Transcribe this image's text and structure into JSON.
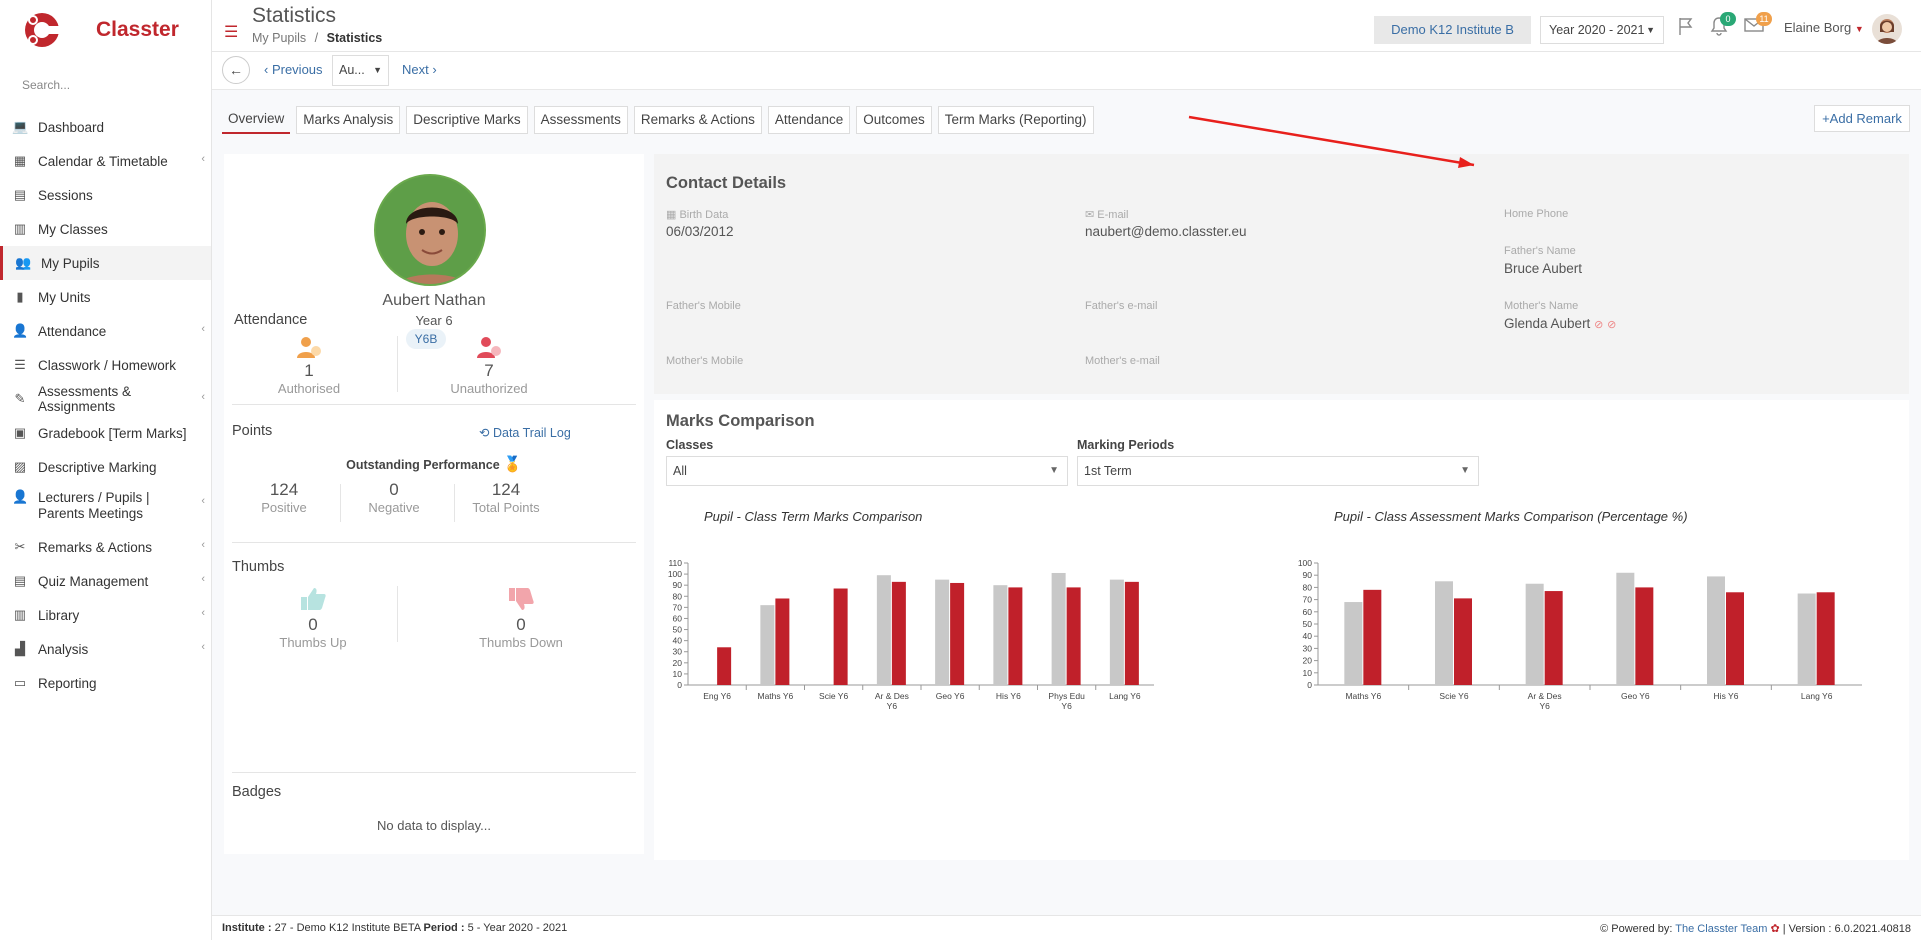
{
  "app": {
    "brand": "Classter",
    "search_placeholder": "Search..."
  },
  "sidebar": {
    "items": [
      {
        "label": "Dashboard",
        "icon": "laptop-icon"
      },
      {
        "label": "Calendar & Timetable",
        "icon": "calendar-icon",
        "arrow": true
      },
      {
        "label": "Sessions",
        "icon": "sessions-icon"
      },
      {
        "label": "My Classes",
        "icon": "classes-icon"
      },
      {
        "label": "My Pupils",
        "icon": "pupils-icon",
        "active": true
      },
      {
        "label": "My Units",
        "icon": "book-icon"
      },
      {
        "label": "Attendance",
        "icon": "attendance-icon",
        "arrow": true
      },
      {
        "label": "Classwork / Homework",
        "icon": "list-icon"
      },
      {
        "label": "Assessments & Assignments",
        "icon": "edit-icon",
        "arrow": true
      },
      {
        "label": "Gradebook [Term Marks]",
        "icon": "gradebook-icon"
      },
      {
        "label": "Descriptive Marking",
        "icon": "descriptive-icon"
      },
      {
        "label": "Lecturers / Pupils | Parents Meetings",
        "icon": "meetings-icon",
        "arrow": true,
        "two": true
      },
      {
        "label": "Remarks & Actions",
        "icon": "remarks-icon",
        "arrow": true
      },
      {
        "label": "Quiz Management",
        "icon": "quiz-icon",
        "arrow": true
      },
      {
        "label": "Library",
        "icon": "library-icon",
        "arrow": true
      },
      {
        "label": "Analysis",
        "icon": "analysis-icon",
        "arrow": true
      },
      {
        "label": "Reporting",
        "icon": "printer-icon"
      }
    ]
  },
  "header": {
    "title": "Statistics",
    "breadcrumb": [
      "My Pupils",
      "Statistics"
    ],
    "institute": "Demo K12 Institute B",
    "year": "Year 2020 - 2021",
    "notifications": "0",
    "messages": "11",
    "user": "Elaine Borg"
  },
  "subbar": {
    "previous": "Previous",
    "pupil": "Au...",
    "next": "Next"
  },
  "tabs": [
    "Overview",
    "Marks Analysis",
    "Descriptive Marks",
    "Assessments",
    "Remarks & Actions",
    "Attendance",
    "Outcomes",
    "Term Marks (Reporting)"
  ],
  "add_remark": "Add Remark",
  "pupil": {
    "name": "Aubert Nathan",
    "year": "Year 6",
    "class": "Y6B"
  },
  "attendance": {
    "title": "Attendance",
    "authorised": {
      "value": "1",
      "label": "Authorised"
    },
    "unauthorized": {
      "value": "7",
      "label": "Unauthorized"
    }
  },
  "points": {
    "title": "Points",
    "link": "Data Trail Log",
    "performance": "Outstanding Performance",
    "positive": {
      "value": "124",
      "label": "Positive"
    },
    "negative": {
      "value": "0",
      "label": "Negative"
    },
    "total": {
      "value": "124",
      "label": "Total Points"
    }
  },
  "thumbs": {
    "title": "Thumbs",
    "up": {
      "value": "0",
      "label": "Thumbs Up"
    },
    "down": {
      "value": "0",
      "label": "Thumbs Down"
    }
  },
  "badges": {
    "title": "Badges",
    "empty": "No data to display..."
  },
  "contact": {
    "title": "Contact Details",
    "birth_label": "Birth Data",
    "birth": "06/03/2012",
    "email_label": "E-mail",
    "email": "naubert@demo.classter.eu",
    "home_phone_label": "Home Phone",
    "father_name_label": "Father's Name",
    "father_name": "Bruce Aubert",
    "father_mobile_label": "Father's Mobile",
    "father_email_label": "Father's e-mail",
    "mother_name_label": "Mother's Name",
    "mother_name": "Glenda Aubert",
    "mother_mobile_label": "Mother's Mobile",
    "mother_email_label": "Mother's e-mail"
  },
  "marks": {
    "title": "Marks Comparison",
    "classes_label": "Classes",
    "classes_value": "All",
    "periods_label": "Marking Periods",
    "periods_value": "1st Term"
  },
  "chart_data": [
    {
      "type": "bar",
      "title": "Pupil - Class Term Marks Comparison",
      "categories": [
        "Eng Y6",
        "Maths Y6",
        "Scie Y6",
        "Ar & Des Y6",
        "Geo Y6",
        "His Y6",
        "Phys Edu Y6",
        "Lang Y6"
      ],
      "series": [
        {
          "values": [
            0,
            72,
            0,
            99,
            95,
            90,
            101,
            95
          ],
          "color": "#c8c8c8"
        },
        {
          "values": [
            34,
            78,
            87,
            93,
            92,
            88,
            88,
            93
          ],
          "color": "#c0202a"
        }
      ],
      "ylim": [
        0,
        110
      ],
      "yticks": [
        0,
        10,
        20,
        30,
        40,
        50,
        60,
        70,
        80,
        90,
        100,
        110
      ]
    },
    {
      "type": "bar",
      "title": "Pupil - Class Assessment Marks Comparison (Percentage %)",
      "categories": [
        "Maths Y6",
        "Scie Y6",
        "Ar & Des Y6",
        "Geo Y6",
        "His Y6",
        "Lang Y6"
      ],
      "series": [
        {
          "values": [
            68,
            85,
            83,
            92,
            89,
            75
          ],
          "color": "#c8c8c8"
        },
        {
          "values": [
            78,
            71,
            77,
            80,
            76,
            76
          ],
          "color": "#c0202a"
        }
      ],
      "ylim": [
        0,
        100
      ],
      "yticks": [
        0,
        10,
        20,
        30,
        40,
        50,
        60,
        70,
        80,
        90,
        100
      ]
    }
  ],
  "footer": {
    "left_label1": "Institute :",
    "left_value1": "27 - Demo K12 Institute BETA",
    "left_label2": "Period :",
    "left_value2": "5 - Year 2020 - 2021",
    "powered": "Powered by:",
    "team": "The Classter Team",
    "version": "| Version : 6.0.2021.40818"
  },
  "colors": {
    "brand": "#c0272d",
    "link": "#3a6ea5",
    "bar_pupil": "#c8c8c8",
    "bar_class": "#c0202a"
  }
}
